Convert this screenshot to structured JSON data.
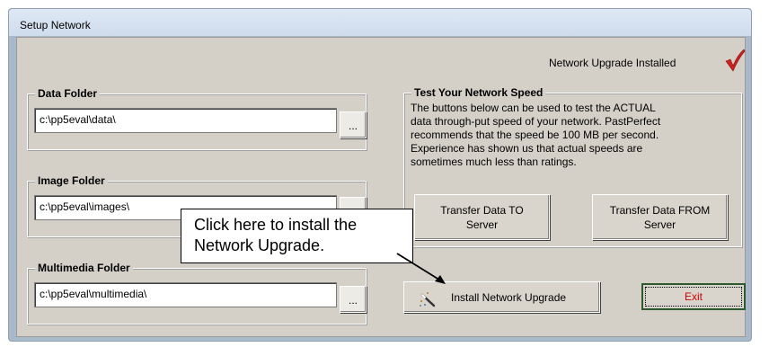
{
  "window": {
    "title": "Setup Network"
  },
  "status": {
    "installed_text": "Network Upgrade Installed",
    "check_color": "#cc2222"
  },
  "data_folder": {
    "label": "Data Folder",
    "path": "c:\\pp5eval\\data\\",
    "browse_label": "..."
  },
  "image_folder": {
    "label": "Image Folder",
    "path": "c:\\pp5eval\\images\\",
    "browse_label": "..."
  },
  "multimedia_folder": {
    "label": "Multimedia Folder",
    "path": "c:\\pp5eval\\multimedia\\",
    "browse_label": "..."
  },
  "speed_test": {
    "label": "Test Your Network Speed",
    "description_lines": [
      "The buttons below can be used to test the ACTUAL",
      "data through-put speed of your network.  PastPerfect",
      "recommends that the speed be 100 MB per second.",
      "Experience has shown us that actual speeds are",
      "sometimes much less than ratings."
    ],
    "to_server_line1": "Transfer Data TO",
    "to_server_line2": "Server",
    "from_server_line1": "Transfer Data FROM",
    "from_server_line2": "Server"
  },
  "actions": {
    "install_label": "Install Network Upgrade",
    "install_icon": "magic-wand-icon",
    "exit_label": "Exit"
  },
  "callout": {
    "line1": "Click here to install the",
    "line2": "Network Upgrade."
  }
}
